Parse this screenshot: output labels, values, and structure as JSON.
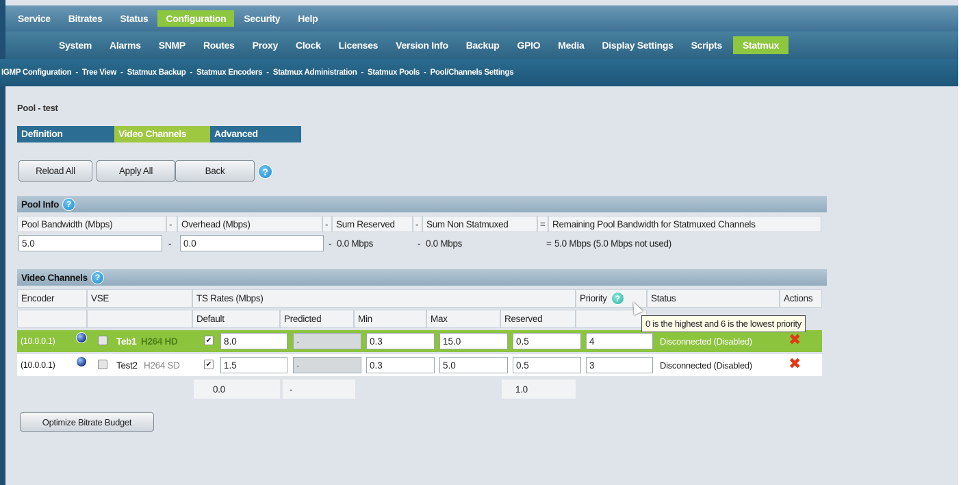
{
  "nav_primary": [
    "Service",
    "Bitrates",
    "Status",
    "Configuration",
    "Security",
    "Help"
  ],
  "nav_primary_active": "Configuration",
  "nav_secondary": [
    "System",
    "Alarms",
    "SNMP",
    "Routes",
    "Proxy",
    "Clock",
    "Licenses",
    "Version Info",
    "Backup",
    "GPIO",
    "Media",
    "Display Settings",
    "Scripts",
    "Statmux"
  ],
  "nav_secondary_active": "Statmux",
  "nav_tertiary": [
    "IGMP Configuration",
    "Tree View",
    "Statmux Backup",
    "Statmux Encoders",
    "Statmux Administration",
    "Statmux Pools",
    "Pool/Channels Settings"
  ],
  "nav_tertiary_sep": "-",
  "page_title": "Pool - test",
  "subtabs": [
    "Definition",
    "Video Channels",
    "Advanced"
  ],
  "subtab_active": "Video Channels",
  "buttons": {
    "reload_all": "Reload All",
    "apply_all": "Apply All",
    "back": "Back",
    "optimize": "Optimize Bitrate Budget"
  },
  "help_glyph": "?",
  "pool_info": {
    "title": "Pool Info",
    "headers": [
      "Pool Bandwidth (Mbps)",
      "Overhead (Mbps)",
      "Sum Reserved",
      "Sum Non Statmuxed",
      "Remaining Pool Bandwidth for Statmuxed Channels"
    ],
    "operators": [
      "-",
      "-",
      "-",
      "="
    ],
    "values": {
      "bandwidth": "5.0",
      "overhead": "0.0",
      "sum_reserved": "0.0 Mbps",
      "sum_non_statmuxed": "0.0 Mbps",
      "remaining": "5.0 Mbps (5.0 Mbps not used)"
    }
  },
  "video_channels": {
    "title": "Video Channels",
    "headers": {
      "encoder": "Encoder",
      "vse": "VSE",
      "ts_rates": "TS Rates (Mbps)",
      "priority": "Priority",
      "status": "Status",
      "actions": "Actions"
    },
    "subheaders": [
      "Default",
      "Predicted",
      "Min",
      "Max",
      "Reserved"
    ],
    "rows": [
      {
        "encoder": "(10.0.0.1)",
        "name": "Teb1",
        "codec": "H264 HD",
        "default": "8.0",
        "predicted": "-",
        "min": "0.3",
        "max": "15.0",
        "reserved": "0.5",
        "priority": "4",
        "status": "Disconnected (Disabled)",
        "checked": "✔"
      },
      {
        "encoder": "(10.0.0.1)",
        "name": "Test2",
        "codec": "H264 SD",
        "default": "1.5",
        "predicted": "-",
        "min": "0.3",
        "max": "5.0",
        "reserved": "0.5",
        "priority": "3",
        "status": "Disconnected (Disabled)",
        "checked": "✔"
      }
    ],
    "totals": {
      "default": "0.0",
      "predicted": "-",
      "reserved": "1.0"
    }
  },
  "tooltip": "0 is the highest and 6 is the lowest priority",
  "icons": {
    "delete": "delete-x-icon",
    "globe": "globe-icon",
    "help": "help-icon"
  },
  "colors": {
    "accent_green": "#8dc63f",
    "nav_blue": "#2b6d93",
    "delete_red": "#e03a17"
  }
}
